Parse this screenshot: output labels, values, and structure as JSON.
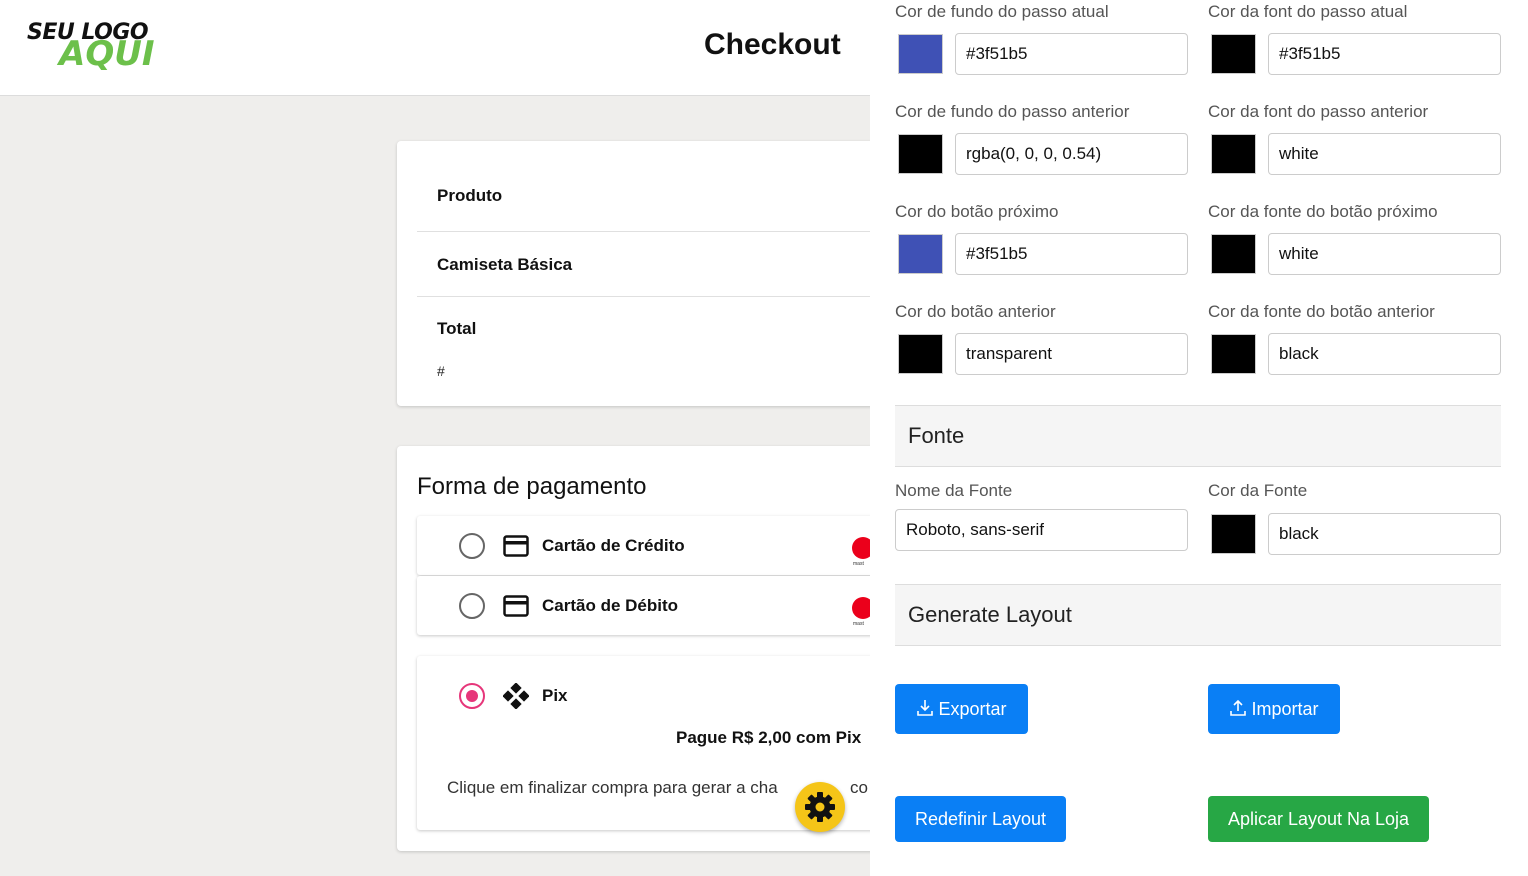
{
  "header": {
    "logo_line1": "SEU LOGO",
    "logo_line2": "AQUI",
    "title": "Checkout"
  },
  "product": {
    "header_label": "Produto",
    "item_name": "Camiseta Básica",
    "total_label": "Total",
    "total_value": "#"
  },
  "payment": {
    "title": "Forma de pagamento",
    "options": [
      {
        "label": "Cartão de Crédito",
        "icon": "credit-card-icon",
        "selected": false,
        "brand": "mastercard"
      },
      {
        "label": "Cartão de Débito",
        "icon": "credit-card-icon",
        "selected": false,
        "brand": "mastercard"
      },
      {
        "label": "Pix",
        "icon": "pix-icon",
        "selected": true
      }
    ],
    "mastercard_text": "mast",
    "pix_price": "Pague R$ 2,00 com Pix",
    "pix_note": "Clique em finalizar compra para gerar a cha",
    "pix_note_tail": "co"
  },
  "settings": {
    "rows": [
      {
        "left": {
          "label": "Cor de fundo do passo atual",
          "swatch": "#3f51b5",
          "value": "#3f51b5"
        },
        "right": {
          "label": "Cor da font do passo atual",
          "swatch": "#000000",
          "value": "#3f51b5"
        }
      },
      {
        "left": {
          "label": "Cor de fundo do passo anterior",
          "swatch": "#000000",
          "value": "rgba(0, 0, 0, 0.54)"
        },
        "right": {
          "label": "Cor da font do passo anterior",
          "swatch": "#000000",
          "value": "white"
        }
      },
      {
        "left": {
          "label": "Cor do botão próximo",
          "swatch": "#3f51b5",
          "value": "#3f51b5"
        },
        "right": {
          "label": "Cor da fonte do botão próximo",
          "swatch": "#000000",
          "value": "white"
        }
      },
      {
        "left": {
          "label": "Cor do botão anterior",
          "swatch": "#000000",
          "value": "transparent"
        },
        "right": {
          "label": "Cor da fonte do botão anterior",
          "swatch": "#000000",
          "value": "black"
        }
      }
    ],
    "font_section": {
      "title": "Fonte",
      "name_label": "Nome da Fonte",
      "name_value": "Roboto, sans-serif",
      "color_label": "Cor da Fonte",
      "color_swatch": "#000000",
      "color_value": "black"
    },
    "layout_section": {
      "title": "Generate Layout",
      "export_label": "Exportar",
      "import_label": "Importar",
      "reset_label": "Redefinir Layout",
      "apply_label": "Aplicar Layout Na Loja"
    }
  },
  "colors": {
    "accent_blue": "#0a7ff5",
    "accent_green": "#27a745",
    "radio_selected": "#e6367a",
    "gear_button": "#f5c518",
    "logo_green": "#6cc04a"
  }
}
